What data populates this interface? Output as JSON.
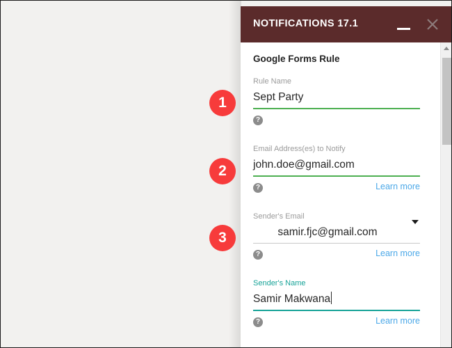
{
  "window": {
    "title": "NOTIFICATIONS 17.1",
    "minimize_label": "minimize",
    "close_label": "close"
  },
  "panel": {
    "section_title": "Google Forms Rule",
    "help_glyph": "?",
    "fields": [
      {
        "label": "Rule Name",
        "value": "Sept Party",
        "underline": "green",
        "learn_more": "",
        "focused": false,
        "type": "text"
      },
      {
        "label": "Email Address(es) to Notify",
        "value": "john.doe@gmail.com",
        "underline": "green",
        "learn_more": "Learn more",
        "focused": false,
        "type": "text"
      },
      {
        "label": "Sender's Email",
        "value": "samir.fjc@gmail.com",
        "underline": "grey",
        "learn_more": "Learn more",
        "focused": false,
        "type": "select"
      },
      {
        "label": "Sender's Name",
        "value": "Samir Makwana",
        "underline": "teal",
        "learn_more": "Learn more",
        "focused": true,
        "type": "text"
      }
    ]
  },
  "badges": [
    {
      "number": "1"
    },
    {
      "number": "2"
    },
    {
      "number": "3"
    }
  ],
  "colors": {
    "titlebar": "#5b2b2b",
    "accent_green": "#4caf50",
    "accent_teal": "#17a398",
    "link_blue": "#4ba8e8",
    "badge_red": "#f73b3b",
    "page_background": "#f2f1ef"
  }
}
